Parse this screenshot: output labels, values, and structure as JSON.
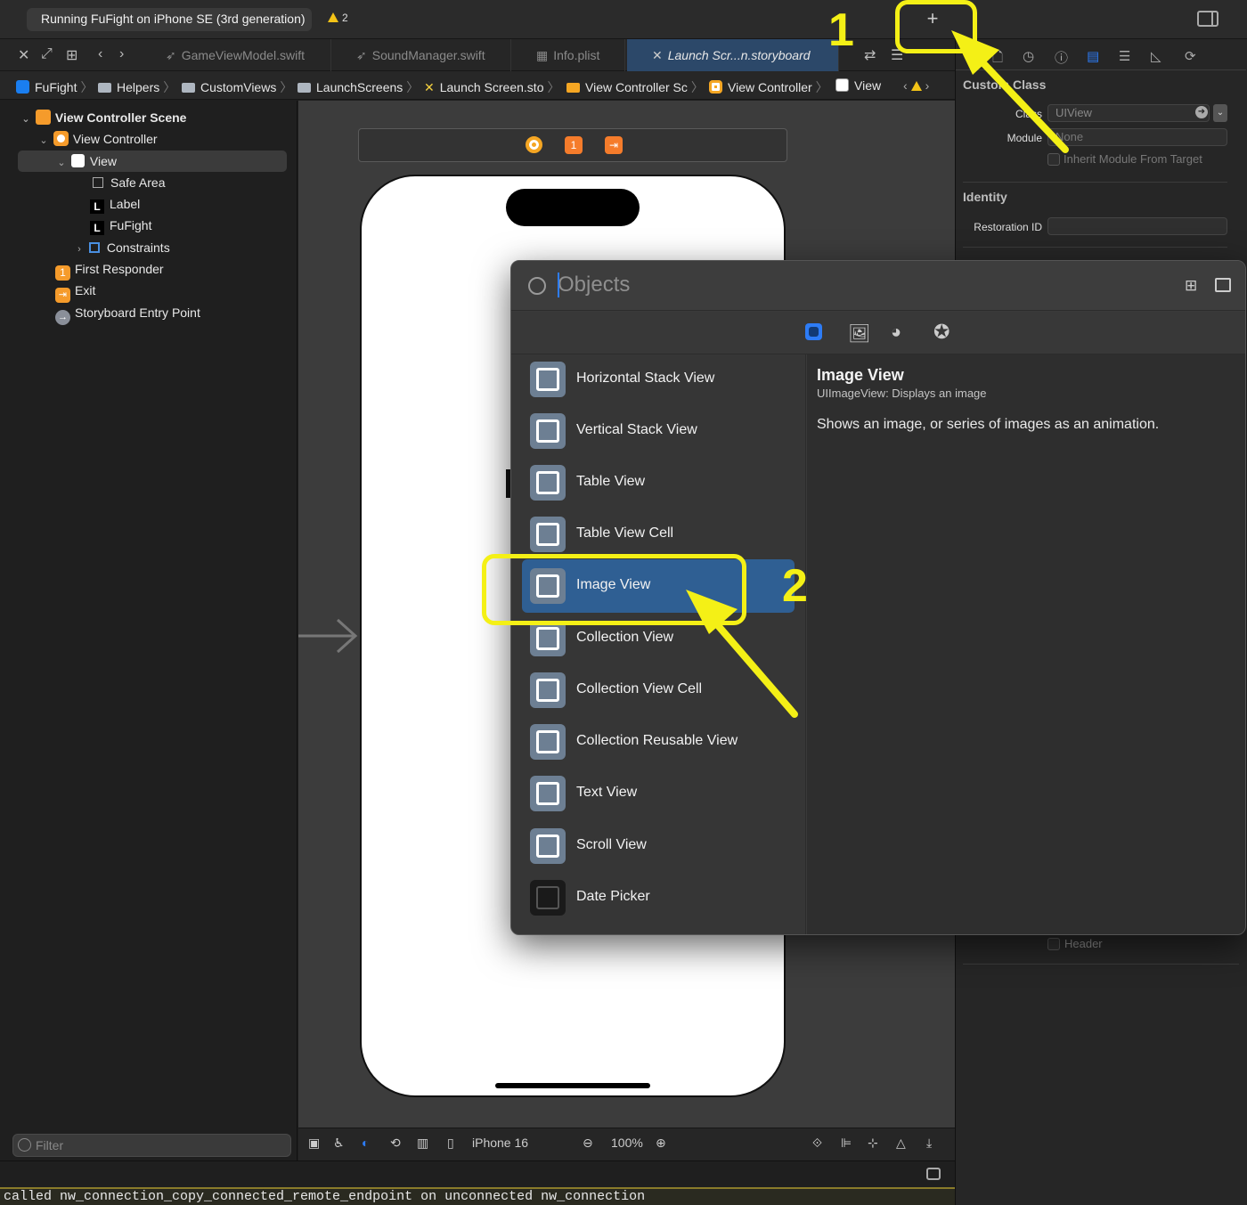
{
  "toolbar": {
    "run_status": "Running FuFight on iPhone SE (3rd generation)",
    "warning_count": "2",
    "add_button": "+"
  },
  "tabs": [
    {
      "label": "GameViewModel.swift",
      "icon": "swift-icon"
    },
    {
      "label": "SoundManager.swift",
      "icon": "swift-icon"
    },
    {
      "label": "Info.plist",
      "icon": "table-icon"
    },
    {
      "label": "Launch Scr...n.storyboard",
      "icon": "storyboard-icon",
      "active": true
    }
  ],
  "breadcrumbs": [
    "FuFight",
    "Helpers",
    "CustomViews",
    "LaunchScreens",
    "Launch Screen.sto",
    "View Controller Sc",
    "View Controller",
    "View"
  ],
  "navigator": {
    "items": [
      {
        "label": "View Controller Scene",
        "icon": "scene-icon"
      },
      {
        "label": "View Controller",
        "icon": "view-controller-icon"
      },
      {
        "label": "View",
        "icon": "view-icon",
        "selected": true
      },
      {
        "label": "Safe Area",
        "icon": "safe-area-icon"
      },
      {
        "label": "Label",
        "icon": "label-icon"
      },
      {
        "label": "FuFight",
        "icon": "label-icon"
      },
      {
        "label": "Constraints",
        "icon": "constraints-icon"
      },
      {
        "label": "First Responder",
        "icon": "first-responder-icon"
      },
      {
        "label": "Exit",
        "icon": "exit-icon"
      },
      {
        "label": "Storyboard Entry Point",
        "icon": "entry-point-icon"
      }
    ],
    "first_responder_badge": "1",
    "label_badge": "L",
    "filter_placeholder": "Filter"
  },
  "scene_bar": {
    "first_responder_badge": "1"
  },
  "canvas_bottom": {
    "device": "iPhone 16",
    "zoom": "100%"
  },
  "console": {
    "line": "called nw_connection_copy_connected_remote_endpoint on unconnected nw_connection"
  },
  "inspector": {
    "custom_class_heading": "Custom Class",
    "class_label": "Class",
    "class_value": "UIView",
    "module_label": "Module",
    "module_value": "None",
    "inherit_label": "Inherit Module From Target",
    "identity_heading": "Identity",
    "restoration_label": "Restoration ID",
    "header_label": "Header"
  },
  "library": {
    "search_placeholder": "Objects",
    "segments": [
      "objects-icon",
      "media-icon",
      "color-icon",
      "snippets-icon"
    ],
    "items": [
      {
        "label": "Horizontal Stack View",
        "icon": "horizontal-stack-icon"
      },
      {
        "label": "Vertical Stack View",
        "icon": "vertical-stack-icon"
      },
      {
        "label": "Table View",
        "icon": "table-view-icon"
      },
      {
        "label": "Table View Cell",
        "icon": "table-cell-icon"
      },
      {
        "label": "Image View",
        "icon": "image-view-icon",
        "selected": true
      },
      {
        "label": "Collection View",
        "icon": "collection-view-icon"
      },
      {
        "label": "Collection View Cell",
        "icon": "collection-cell-icon"
      },
      {
        "label": "Collection Reusable View",
        "icon": "collection-reusable-icon"
      },
      {
        "label": "Text View",
        "icon": "text-view-icon"
      },
      {
        "label": "Scroll View",
        "icon": "scroll-view-icon"
      },
      {
        "label": "Date Picker",
        "icon": "date-picker-icon"
      }
    ],
    "detail": {
      "title": "Image View",
      "subtitle": "UIImageView: Displays an image",
      "description": "Shows an image, or series of images as an animation."
    }
  },
  "annotations": {
    "step1": "1",
    "step2": "2",
    "color": "#f4f016"
  },
  "colors": {
    "accent": "#2d7cf6",
    "selection": "#2f5f93",
    "warning": "#f3c317",
    "orange": "#f59b2b"
  }
}
